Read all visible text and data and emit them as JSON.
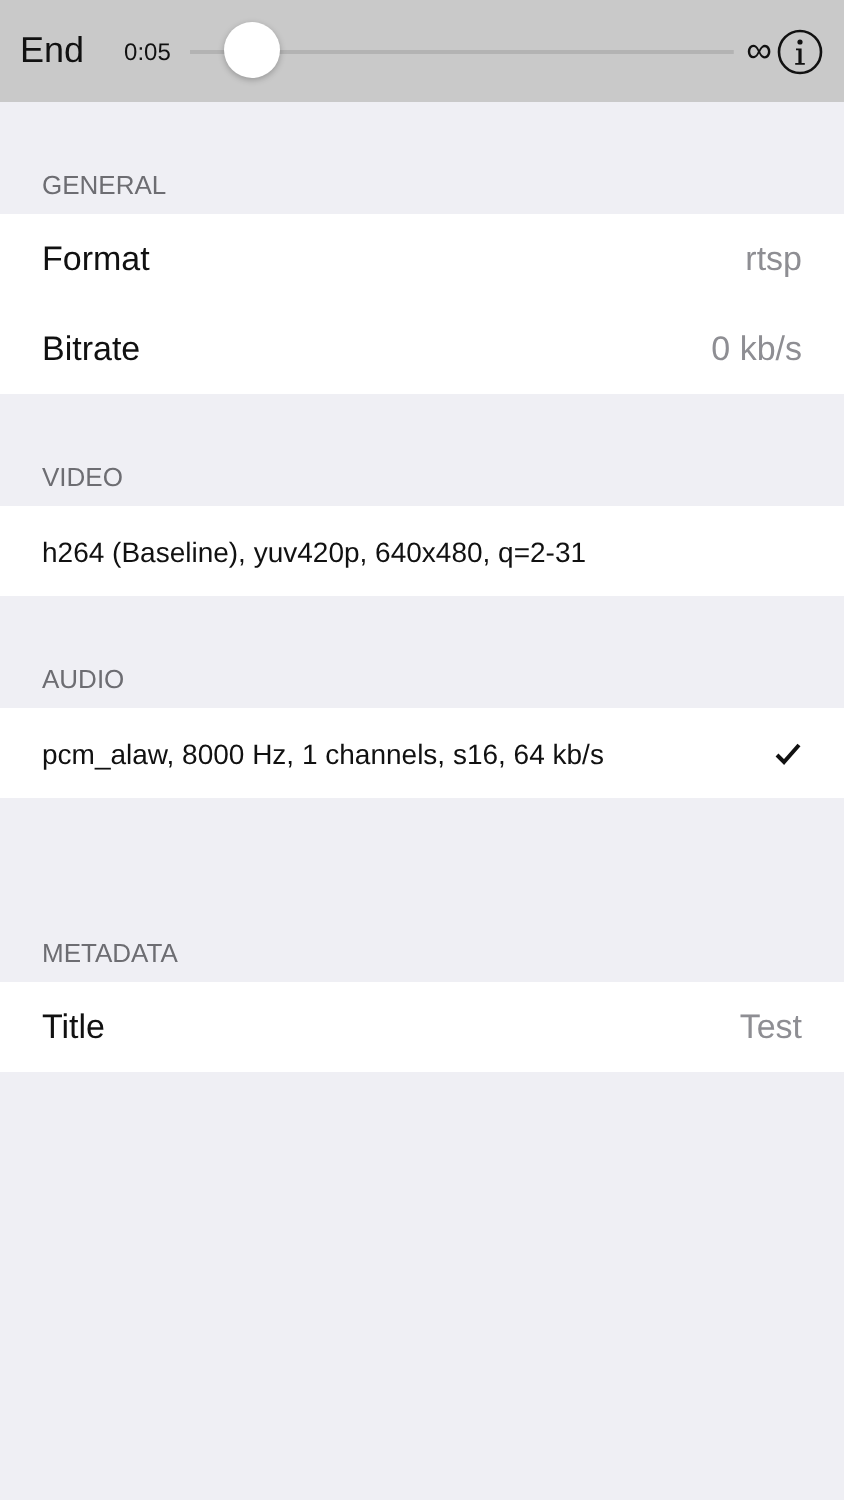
{
  "toolbar": {
    "end_label": "End",
    "time": "0:05",
    "level": 0.07,
    "duration": "∞"
  },
  "sections": [
    {
      "header": "GENERAL",
      "rows": [
        {
          "kind": "value",
          "label": "Format",
          "value": "rtsp"
        },
        {
          "kind": "value",
          "label": "Bitrate",
          "value": "0 kb/s"
        }
      ]
    },
    {
      "header": "VIDEO",
      "rows": [
        {
          "kind": "stream",
          "label": "h264 (Baseline), yuv420p, 640x480, q=2-31",
          "checked": false
        }
      ]
    },
    {
      "header": "AUDIO",
      "rows": [
        {
          "kind": "stream",
          "label": "pcm_alaw, 8000 Hz, 1 channels, s16, 64 kb/s",
          "checked": true
        }
      ]
    },
    {
      "header": "METADATA",
      "rows": [
        {
          "kind": "value",
          "label": "Title",
          "value": "Test"
        }
      ]
    }
  ]
}
